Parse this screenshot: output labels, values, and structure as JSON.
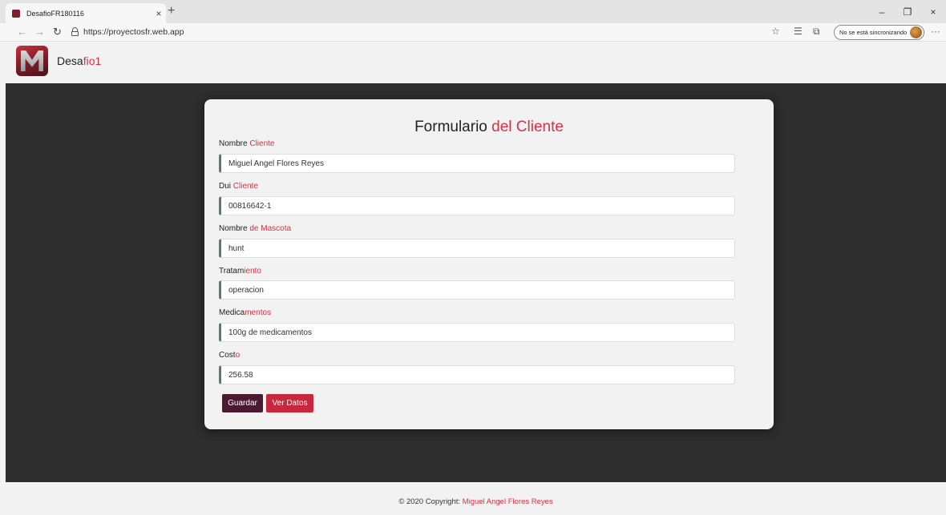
{
  "browser": {
    "tab_title": "DesafioFR180116",
    "tab_close": "×",
    "new_tab": "+",
    "url": "https://proyectosfr.web.app",
    "sync_label": "No se está sincronizando",
    "window_controls": [
      "–",
      "❐",
      "×"
    ],
    "more": "···"
  },
  "navbar": {
    "brand_prefix": "Desa",
    "brand_accent": "fio1"
  },
  "form": {
    "title_prefix": "Formulario ",
    "title_accent": "del Cliente",
    "fields": [
      {
        "label_prefix": "Nombre ",
        "label_accent": "Cliente",
        "value": "Miguel Angel Flores Reyes"
      },
      {
        "label_prefix": "Dui ",
        "label_accent": "Cliente",
        "value": "00816642-1"
      },
      {
        "label_prefix": "Nombre ",
        "label_accent": "de Mascota",
        "value": "hunt"
      },
      {
        "label_prefix": "Tratam",
        "label_accent": "iento",
        "value": "operacion"
      },
      {
        "label_prefix": "Medica",
        "label_accent": "mentos",
        "value": "100g de medicamentos"
      },
      {
        "label_prefix": "Cost",
        "label_accent": "o",
        "value": "256.58"
      }
    ],
    "save_label": "Guardar",
    "view_label": "Ver Datos"
  },
  "footer": {
    "copyright": "© 2020 Copyright: ",
    "author": "Miguel Angel Flores Reyes"
  },
  "colors": {
    "accent": "#dc2f45",
    "dark_bg": "#2d2d2d",
    "save_button": "#4a1a30",
    "view_button": "#c8283e",
    "input_border": "#5b7c63"
  }
}
